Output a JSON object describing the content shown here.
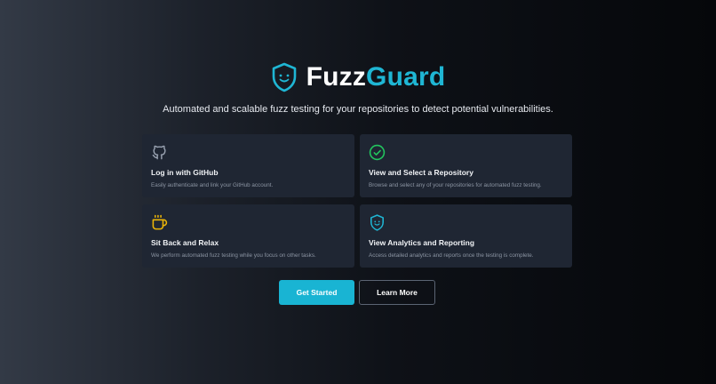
{
  "brand": {
    "name_part1": "Fuzz",
    "name_part2": "Guard",
    "logo_icon": "shield-smile-icon",
    "accent_color": "#1fb6d4"
  },
  "tagline": "Automated and scalable fuzz testing for your repositories to detect potential vulnerabilities.",
  "features": [
    {
      "icon": "github-icon",
      "title": "Log in with GitHub",
      "description": "Easily authenticate and link your GitHub account."
    },
    {
      "icon": "check-circle-icon",
      "icon_color": "#22c55e",
      "title": "View and Select a Repository",
      "description": "Browse and select any of your repositories for automated fuzz testing."
    },
    {
      "icon": "coffee-icon",
      "icon_color": "#eab308",
      "title": "Sit Back and Relax",
      "description": "We perform automated fuzz testing while you focus on other tasks."
    },
    {
      "icon": "shield-smile-icon",
      "icon_color": "#1fb6d4",
      "title": "View Analytics and Reporting",
      "description": "Access detailed analytics and reports once the testing is complete."
    }
  ],
  "actions": {
    "primary_label": "Get Started",
    "secondary_label": "Learn More"
  }
}
